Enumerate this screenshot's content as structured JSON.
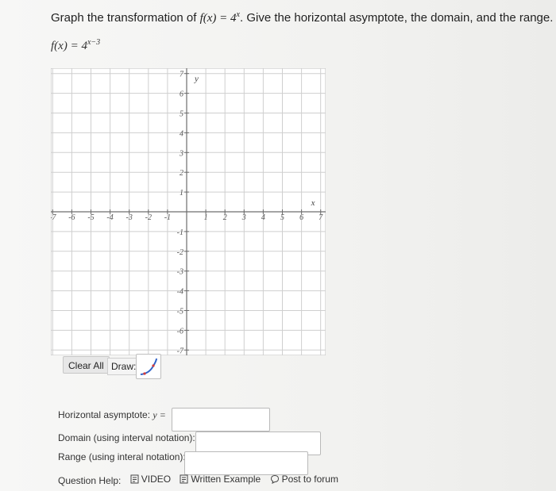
{
  "question": {
    "prefix": "Graph the transformation of ",
    "function_name": "f(x) = 4",
    "exponent": "x",
    "suffix": ". Give the horizontal asymptote, the domain, and the range."
  },
  "function_display": {
    "lhs": "f(x) = 4",
    "exponent": "x−3"
  },
  "graph": {
    "x_axis_label": "x",
    "y_axis_label": "y",
    "x_ticks": [
      "-7",
      "-6",
      "-5",
      "-4",
      "-3",
      "-2",
      "-1",
      "1",
      "2",
      "3",
      "4",
      "5",
      "6",
      "7"
    ],
    "y_ticks": [
      "7",
      "6",
      "5",
      "4",
      "3",
      "2",
      "1",
      "-1",
      "-2",
      "-3",
      "-4",
      "-5",
      "-6",
      "-7"
    ],
    "x_range": [
      -7,
      7
    ],
    "y_range": [
      -7,
      7
    ],
    "grid": true
  },
  "toolbar": {
    "clear_label": "Clear All",
    "draw_label": "Draw:",
    "draw_tool_icon": "exponential-curve-icon",
    "draw_tool_color": "#2f63c9"
  },
  "answers": {
    "asymptote_label": "Horizontal asymptote: ",
    "asymptote_var": "y =",
    "asymptote_value": "",
    "domain_label": "Domain (using interval notation):",
    "domain_value": "",
    "range_label": "Range (using interal notation):",
    "range_value": ""
  },
  "help": {
    "label": "Question Help:",
    "video_label": "VIDEO",
    "example_label": "Written Example",
    "forum_label": "Post to forum"
  }
}
